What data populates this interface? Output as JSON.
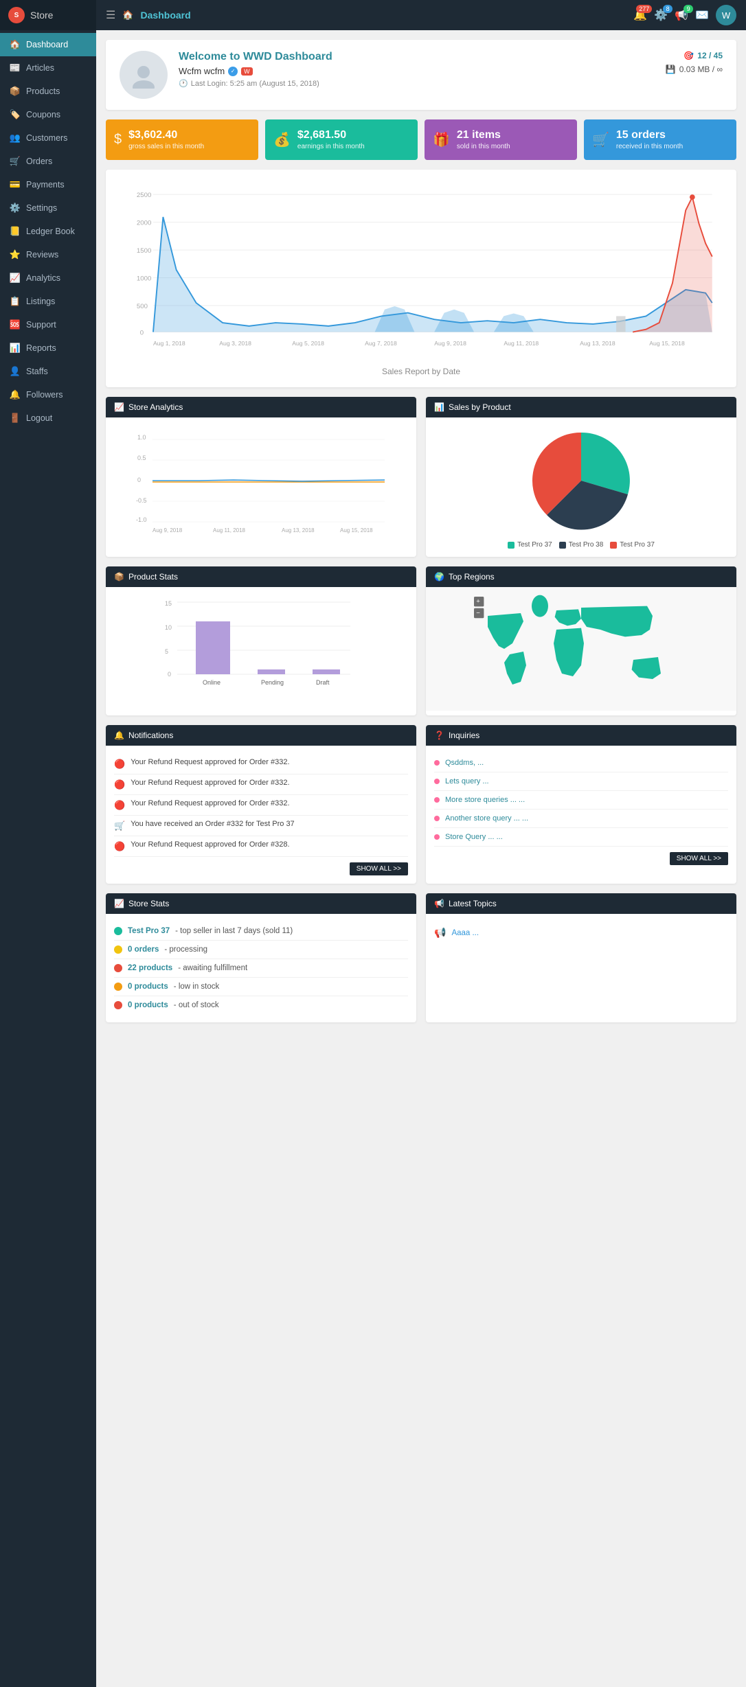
{
  "sidebar": {
    "store_label": "Store",
    "items": [
      {
        "label": "Dashboard",
        "icon": "🏠",
        "active": true,
        "name": "dashboard"
      },
      {
        "label": "Articles",
        "icon": "📰",
        "active": false,
        "name": "articles"
      },
      {
        "label": "Products",
        "icon": "📦",
        "active": false,
        "name": "products"
      },
      {
        "label": "Coupons",
        "icon": "🏷️",
        "active": false,
        "name": "coupons"
      },
      {
        "label": "Customers",
        "icon": "👥",
        "active": false,
        "name": "customers"
      },
      {
        "label": "Orders",
        "icon": "🛒",
        "active": false,
        "name": "orders"
      },
      {
        "label": "Payments",
        "icon": "💳",
        "active": false,
        "name": "payments"
      },
      {
        "label": "Settings",
        "icon": "⚙️",
        "active": false,
        "name": "settings"
      },
      {
        "label": "Ledger Book",
        "icon": "📒",
        "active": false,
        "name": "ledger-book"
      },
      {
        "label": "Reviews",
        "icon": "⭐",
        "active": false,
        "name": "reviews"
      },
      {
        "label": "Analytics",
        "icon": "📈",
        "active": false,
        "name": "analytics"
      },
      {
        "label": "Listings",
        "icon": "📋",
        "active": false,
        "name": "listings"
      },
      {
        "label": "Support",
        "icon": "🆘",
        "active": false,
        "name": "support"
      },
      {
        "label": "Reports",
        "icon": "📊",
        "active": false,
        "name": "reports"
      },
      {
        "label": "Staffs",
        "icon": "👤",
        "active": false,
        "name": "staffs"
      },
      {
        "label": "Followers",
        "icon": "🔔",
        "active": false,
        "name": "followers"
      },
      {
        "label": "Logout",
        "icon": "🚪",
        "active": false,
        "name": "logout"
      }
    ]
  },
  "topbar": {
    "title": "Dashboard",
    "notifications_count": "277",
    "settings_count": "8",
    "announcements_count": "9"
  },
  "welcome": {
    "title": "Welcome to WWD Dashboard",
    "username": "Wcfm wcfm",
    "last_login": "Last Login: 5:25 am (August 15, 2018)",
    "storage": "0.03 MB / ∞",
    "level": "12 / 45"
  },
  "stats": [
    {
      "value": "$3,602.40",
      "label": "gross sales in this month",
      "color": "orange",
      "icon": "$"
    },
    {
      "value": "$2,681.50",
      "label": "earnings in this month",
      "color": "teal",
      "icon": "💰"
    },
    {
      "value": "21 items",
      "label": "sold in this month",
      "color": "purple",
      "icon": "🎁"
    },
    {
      "value": "15 orders",
      "label": "received in this month",
      "color": "blue",
      "icon": "🛒"
    }
  ],
  "sales_chart": {
    "title": "Sales Report by Date",
    "x_labels": [
      "Aug 1, 2018",
      "Aug 3, 2018",
      "Aug 5, 2018",
      "Aug 7, 2018",
      "Aug 9, 2018",
      "Aug 11, 2018",
      "Aug 13, 2018",
      "Aug 15, 2018"
    ],
    "y_labels": [
      "0",
      "500",
      "1000",
      "1500",
      "2000",
      "2500"
    ]
  },
  "store_analytics": {
    "title": "Store Analytics",
    "x_labels": [
      "Aug 9, 2018",
      "Aug 11, 2018",
      "Aug 13, 2018",
      "Aug 15, 2018"
    ],
    "y_labels": [
      "-1.0",
      "-0.5",
      "0",
      "0.5",
      "1.0"
    ]
  },
  "sales_by_product": {
    "title": "Sales by Product",
    "legend": [
      {
        "label": "Test Pro 37",
        "color": "#1abc9c"
      },
      {
        "label": "Test Pro 38",
        "color": "#2c3e50"
      },
      {
        "label": "Test Pro 37",
        "color": "#e74c3c"
      }
    ]
  },
  "product_stats": {
    "title": "Product Stats",
    "bars": [
      {
        "label": "Online",
        "value": 11,
        "color": "#b39ddb"
      },
      {
        "label": "Pending",
        "value": 1,
        "color": "#b39ddb"
      },
      {
        "label": "Draft",
        "value": 1,
        "color": "#b39ddb"
      }
    ],
    "max": 15
  },
  "top_regions": {
    "title": "Top Regions"
  },
  "notifications": {
    "title": "Notifications",
    "items": [
      {
        "text": "Your Refund Request approved for Order #332.",
        "type": "red"
      },
      {
        "text": "Your Refund Request approved for Order #332.",
        "type": "red"
      },
      {
        "text": "Your Refund Request approved for Order #332.",
        "type": "red"
      },
      {
        "text": "You have received an Order #332 for Test Pro 37",
        "type": "teal"
      },
      {
        "text": "Your Refund Request approved for Order #328.",
        "type": "red"
      }
    ],
    "show_all_label": "SHOW ALL >>"
  },
  "inquiries": {
    "title": "Inquiries",
    "items": [
      {
        "text": "Qsddms, ..."
      },
      {
        "text": "Lets query ..."
      },
      {
        "text": "More store queries ... ..."
      },
      {
        "text": "Another store query ... ..."
      },
      {
        "text": "Store Query ... ..."
      }
    ],
    "show_all_label": "SHOW ALL >>"
  },
  "store_stats": {
    "title": "Store Stats",
    "items": [
      {
        "link": "Test Pro 37",
        "desc": "- top seller in last 7 days (sold 11)",
        "dot": "teal"
      },
      {
        "link": "0 orders",
        "desc": "- processing",
        "dot": "yellow"
      },
      {
        "link": "22 products",
        "desc": "- awaiting fulfillment",
        "dot": "red"
      },
      {
        "link": "0 products",
        "desc": "- low in stock",
        "dot": "orange"
      },
      {
        "link": "0 products",
        "desc": "- out of stock",
        "dot": "red"
      }
    ]
  },
  "latest_topics": {
    "title": "Latest Topics",
    "items": [
      {
        "text": "Aaaa ..."
      }
    ]
  }
}
